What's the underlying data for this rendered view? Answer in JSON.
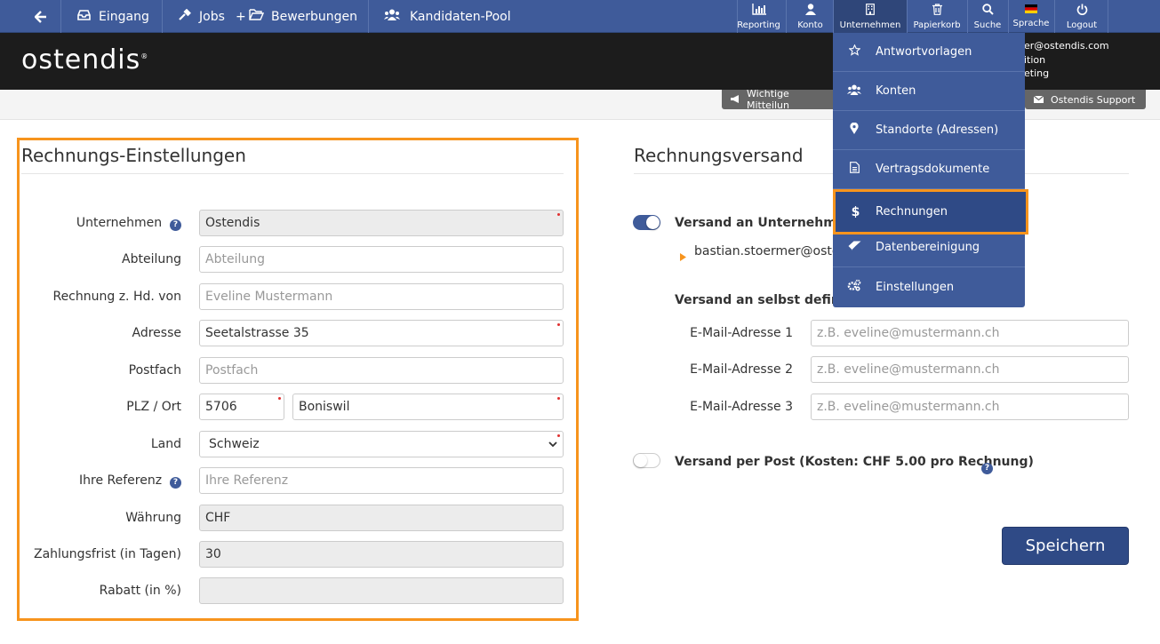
{
  "nav": {
    "back_icon": "arrow-left",
    "eingang": "Eingang",
    "jobs": "Jobs",
    "plus": "+",
    "bewerbungen": "Bewerbungen",
    "kandidaten_pool": "Kandidaten-Pool",
    "reporting": "Reporting",
    "konto": "Konto",
    "unternehmen": "Unternehmen",
    "papierkorb": "Papierkorb",
    "suche": "Suche",
    "sprache": "Sprache",
    "logout": "Logout"
  },
  "brand": {
    "logo": "ostendis",
    "reg": "®"
  },
  "user": {
    "line1": "er@ostendis.com",
    "line2": "ition",
    "line3": "eting"
  },
  "strip": {
    "wichtige": "Wichtige Mitteilun",
    "support": "Ostendis Support"
  },
  "left": {
    "title": "Rechnungs-Einstellungen",
    "unternehmen_label": "Unternehmen",
    "unternehmen_value": "Ostendis",
    "abteilung_label": "Abteilung",
    "abteilung_placeholder": "Abteilung",
    "zhd_label": "Rechnung z. Hd. von",
    "zhd_placeholder": "Eveline Mustermann",
    "adresse_label": "Adresse",
    "adresse_value": "Seetalstrasse 35",
    "postfach_label": "Postfach",
    "postfach_placeholder": "Postfach",
    "plzort_label": "PLZ / Ort",
    "plz_value": "5706",
    "ort_value": "Boniswil",
    "land_label": "Land",
    "land_value": "Schweiz",
    "referenz_label": "Ihre Referenz",
    "referenz_placeholder": "Ihre Referenz",
    "waehrung_label": "Währung",
    "waehrung_value": "CHF",
    "frist_label": "Zahlungsfrist (in Tagen)",
    "frist_value": "30",
    "rabatt_label": "Rabatt (in %)",
    "rabatt_value": ""
  },
  "right": {
    "title": "Rechnungsversand",
    "versand_unternehmen": "Versand an Unternehmens",
    "email_current": "bastian.stoermer@oster",
    "versand_selbst": "Versand an selbst definiert",
    "email1_label": "E-Mail-Adresse 1",
    "email2_label": "E-Mail-Adresse 2",
    "email3_label": "E-Mail-Adresse 3",
    "email_placeholder": "z.B. eveline@mustermann.ch",
    "versand_post": "Versand per Post (Kosten: CHF 5.00 pro Rechnung)",
    "speichern": "Speichern"
  },
  "dropdown": {
    "antwortvorlagen": "Antwortvorlagen",
    "konten": "Konten",
    "standorte": "Standorte (Adressen)",
    "vertragsdokumente": "Vertragsdokumente",
    "rechnungen": "Rechnungen",
    "datenbereinigung": "Datenbereinigung",
    "einstellungen": "Einstellungen"
  },
  "colors": {
    "nav": "#3f5b9a",
    "accent": "#f7941d",
    "brandbar": "#1c1c1c"
  }
}
